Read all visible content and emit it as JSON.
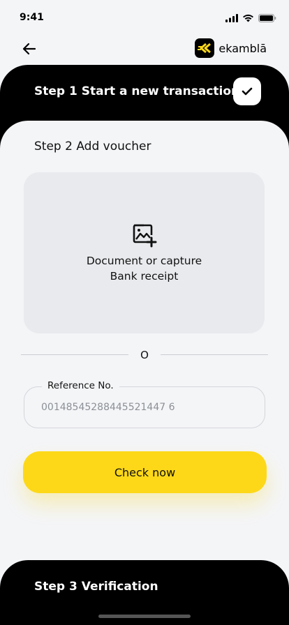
{
  "status_bar": {
    "time": "9:41",
    "icons": [
      "signal-icon",
      "wifi-icon",
      "battery-icon"
    ]
  },
  "header": {
    "back_icon": "back-arrow-icon",
    "logo_text": "ekamblā"
  },
  "step1": {
    "title": "Step 1 Start a new transaction",
    "completed": true,
    "icon": "checkmark-icon"
  },
  "step2": {
    "title": "Step 2 Add voucher",
    "upload": {
      "icon": "add-image-icon",
      "line1": "Document or capture",
      "line2": "Bank receipt"
    },
    "divider_text": "O",
    "reference": {
      "label": "Reference No.",
      "placeholder": "00148545288445521447 6"
    },
    "button_label": "Check now"
  },
  "step3": {
    "title": "Step 3 Verification"
  },
  "colors": {
    "accent_yellow": "#fdd818",
    "card_black": "#000000",
    "background": "#f4f5f7"
  }
}
